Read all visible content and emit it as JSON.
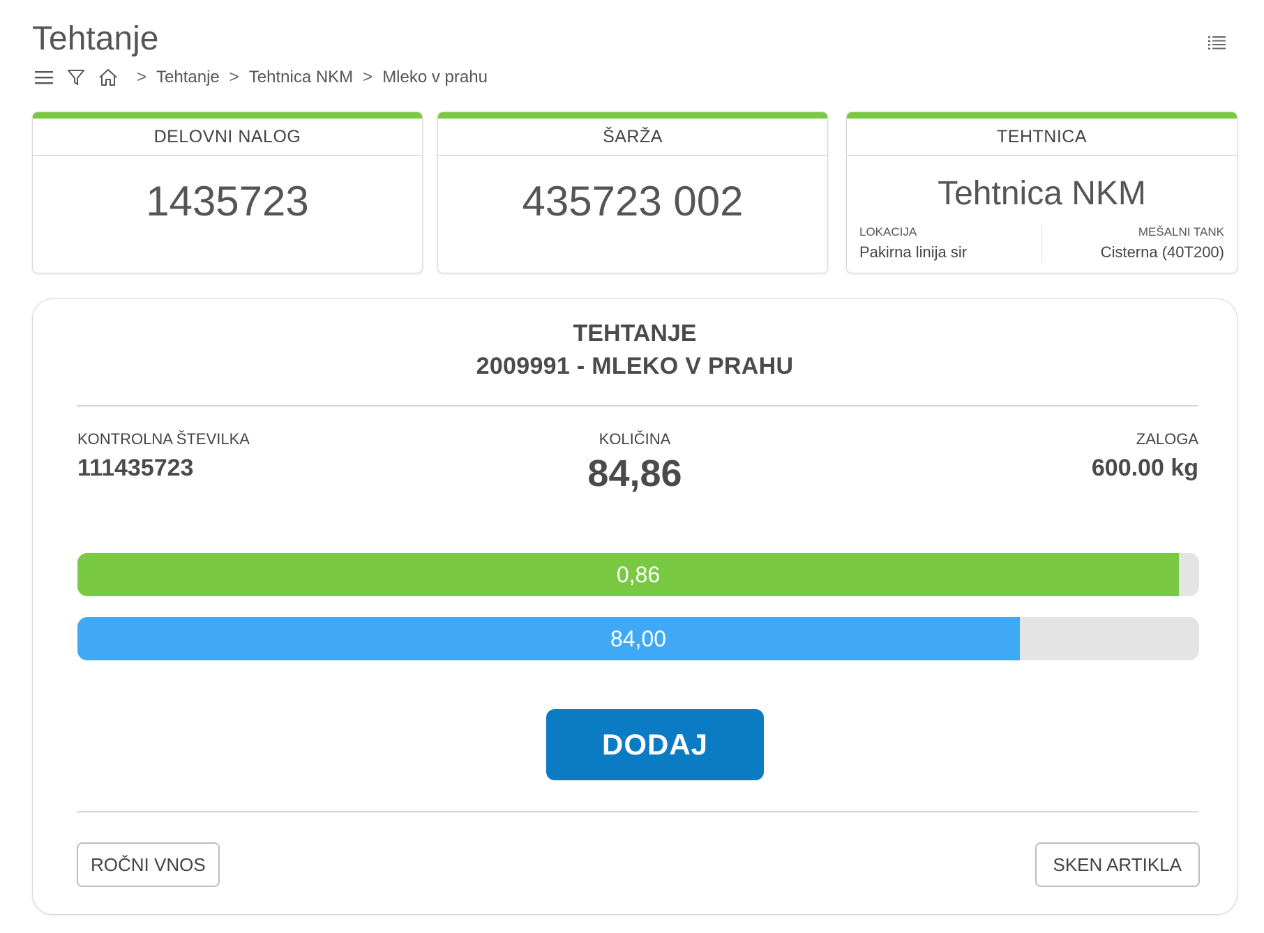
{
  "page": {
    "title": "Tehtanje"
  },
  "icons": {
    "list": "list-icon",
    "menu": "hamburger-icon",
    "filter": "filter-icon",
    "home": "home-icon"
  },
  "breadcrumb": {
    "separator": ">",
    "items": [
      "Tehtanje",
      "Tehtnica NKM",
      "Mleko v prahu"
    ]
  },
  "cards": {
    "delovni_nalog": {
      "label": "DELOVNI NALOG",
      "value": "1435723"
    },
    "sarza": {
      "label": "ŠARŽA",
      "value": "435723 002"
    },
    "tehtnica": {
      "label": "TEHTNICA",
      "value": "Tehtnica NKM",
      "lokacija_label": "LOKACIJA",
      "lokacija_value": "Pakirna linija sir",
      "tank_label": "MEŠALNI TANK",
      "tank_value": "Cisterna (40T200)"
    }
  },
  "weighing": {
    "title": "TEHTANJE",
    "subtitle": "2009991 - MLEKO V PRAHU",
    "control_label": "KONTROLNA ŠTEVILKA",
    "control_value": "111435723",
    "quantity_label": "KOLIČINA",
    "quantity_value": "84,86",
    "stock_label": "ZALOGA",
    "stock_value": "600.00 kg",
    "bars": [
      {
        "label": "0,86",
        "fraction": 0.982,
        "color": "#7ac943"
      },
      {
        "label": "84,00",
        "fraction": 0.84,
        "color": "#3fa9f5"
      }
    ],
    "add_button": "DODAJ",
    "manual_button": "ROČNI VNOS",
    "scan_button": "SKEN ARTIKLA"
  }
}
